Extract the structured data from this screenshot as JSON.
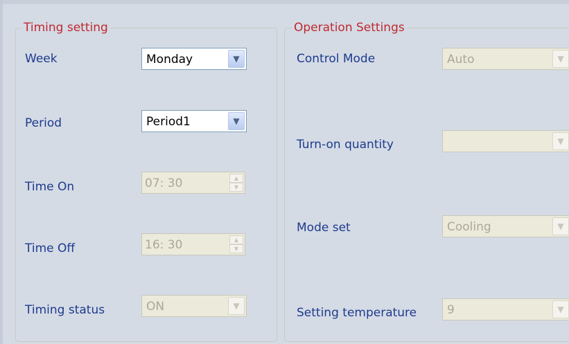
{
  "timing": {
    "title": "Timing setting",
    "week": {
      "label": "Week",
      "value": "Monday",
      "arrow": "chevron-down-icon"
    },
    "period": {
      "label": "Period",
      "value": "Period1",
      "arrow": "chevron-down-icon"
    },
    "time_on": {
      "label": "Time On",
      "value": "07:  30"
    },
    "time_off": {
      "label": "Time Off",
      "value": "16:  30"
    },
    "status": {
      "label": "Timing status",
      "value": "ON"
    }
  },
  "operation": {
    "title": "Operation Settings",
    "control_mode": {
      "label": "Control Mode",
      "value": "Auto"
    },
    "turn_on_quantity": {
      "label": "Turn-on quantity",
      "value": ""
    },
    "mode_set": {
      "label": "Mode set",
      "value": "Cooling"
    },
    "setting_temperature": {
      "label": "Setting temperature",
      "value": "9"
    }
  },
  "colors": {
    "background": "#d4dbe5",
    "legend": "#c0282e",
    "label": "#1e3a8c",
    "disabled_text": "#aca899",
    "disabled_field": "#ebeadb"
  }
}
